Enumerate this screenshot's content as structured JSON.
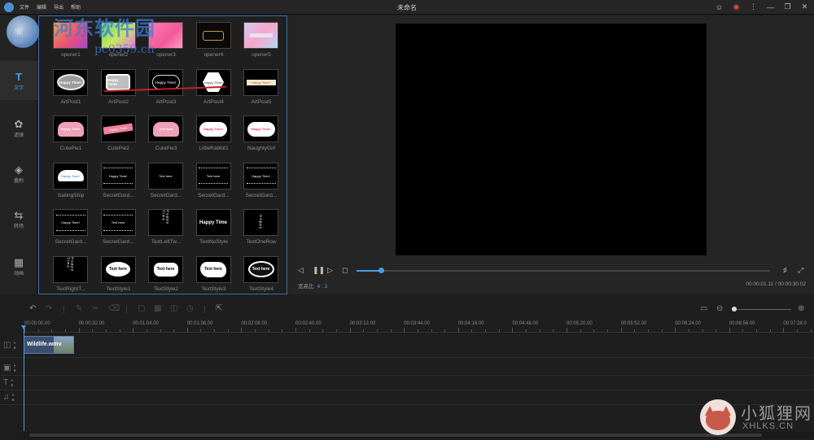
{
  "window": {
    "title": "未命名",
    "menu": [
      "文件",
      "编辑",
      "导出",
      "帮助"
    ]
  },
  "watermark_top": {
    "text": "河东软件园",
    "url": "pc0359.cn"
  },
  "watermark_bottom": {
    "text": "小狐狸网",
    "url": "XHLKS.CN"
  },
  "sidebar": {
    "items": [
      {
        "label": "素材",
        "icon": "media-icon"
      },
      {
        "label": "文字",
        "icon": "text-icon"
      },
      {
        "label": "滤镜",
        "icon": "filter-icon"
      },
      {
        "label": "叠附",
        "icon": "overlay-icon"
      },
      {
        "label": "转场",
        "icon": "transition-icon"
      },
      {
        "label": "动画",
        "icon": "animation-icon"
      }
    ],
    "active_index": 1
  },
  "library": {
    "items": [
      {
        "label": "opener1",
        "style": "opener1"
      },
      {
        "label": "opener2",
        "style": "opener2"
      },
      {
        "label": "opener3",
        "style": "opener3"
      },
      {
        "label": "opener4",
        "style": "opener4"
      },
      {
        "label": "opener5",
        "style": "opener5"
      },
      {
        "label": "ArtPost1",
        "style": "oval",
        "thumb_text": "Happy Time!"
      },
      {
        "label": "ArtPost2",
        "style": "rect",
        "thumb_text": "Happy Time!"
      },
      {
        "label": "ArtPost3",
        "style": "ornate",
        "thumb_text": "Happy Time!"
      },
      {
        "label": "ArtPost4",
        "style": "hex",
        "thumb_text": "Happy Time!"
      },
      {
        "label": "ArtPost5",
        "style": "bar",
        "thumb_text": "Happy Time!"
      },
      {
        "label": "CutePie1",
        "style": "pie",
        "thumb_text": "Happy Time!"
      },
      {
        "label": "CutePie2",
        "style": "ribbon",
        "thumb_text": "Happy Time!"
      },
      {
        "label": "CutePie3",
        "style": "pie",
        "thumb_text": "Text here"
      },
      {
        "label": "LittleRabbit1",
        "style": "cloud",
        "thumb_text": "Happy Time!"
      },
      {
        "label": "NaughtyGirl",
        "style": "cloud",
        "thumb_text": "Happy Time!"
      },
      {
        "label": "SailingShip",
        "style": "ship",
        "thumb_text": "Happy Time!"
      },
      {
        "label": "SecretGard...",
        "style": "ornate-frame",
        "thumb_text": "Happy Time!"
      },
      {
        "label": "SecretGard...",
        "style": "tiny",
        "thumb_text": "Text here"
      },
      {
        "label": "SecretGard...",
        "style": "ornate-frame",
        "thumb_text": "Text here"
      },
      {
        "label": "SecretGard...",
        "style": "ornate-frame",
        "thumb_text": "Happy Time!"
      },
      {
        "label": "SecretGard...",
        "style": "ornate-frame",
        "thumb_text": "Happy Time!"
      },
      {
        "label": "SecretGard...",
        "style": "ornate-frame",
        "thumb_text": "Text here"
      },
      {
        "label": "TextLeftTw...",
        "style": "vert",
        "thumb_text": "Happy Time"
      },
      {
        "label": "TextNoStyle",
        "style": "plain",
        "thumb_text": "Happy Time"
      },
      {
        "label": "TextOneRow",
        "style": "vert",
        "thumb_text": "Happy"
      },
      {
        "label": "TextRightT...",
        "style": "vert",
        "thumb_text": "Happy Time"
      },
      {
        "label": "TextStyle1",
        "style": "bubble",
        "thumb_text": "Text here"
      },
      {
        "label": "TextStyle2",
        "style": "bubble-sq",
        "thumb_text": "Text here"
      },
      {
        "label": "TextStyle3",
        "style": "bubble-cloud",
        "thumb_text": "Text here"
      },
      {
        "label": "TextStyle4",
        "style": "bubble-round",
        "thumb_text": "Text here"
      }
    ]
  },
  "preview": {
    "aspect_label": "宽高比",
    "aspect_value": "4 : 3",
    "timecode": "00:00:01.11 / 00:00:30.02",
    "progress": 0.06
  },
  "timeline": {
    "ruler": [
      "00:00:00.00",
      "00:00:32.00",
      "00:01:04.00",
      "00:01:36.00",
      "00:02:08.00",
      "00:02:40.00",
      "00:03:12.00",
      "00:03:44.00",
      "00:04:16.00",
      "00:04:48.00",
      "00:05:20.00",
      "00:05:52.00",
      "00:06:24.00",
      "00:06:56.00",
      "00:07:28.0"
    ],
    "clip": {
      "label": "Wildlife.wmv"
    },
    "zoom": 0.02
  },
  "colors": {
    "accent": "#4a9be8",
    "panel_border": "#3d6fa8",
    "background": "#1e1e1e"
  }
}
